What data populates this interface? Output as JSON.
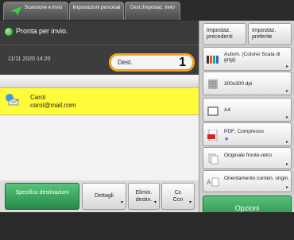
{
  "tabs": [
    {
      "label": "Scansione e invio"
    },
    {
      "label": "Impostazioni personali"
    },
    {
      "label": "Dest./Impostaz. invio"
    }
  ],
  "status": {
    "text": "Pronta per invio.",
    "datetime": "11/11 2020 14:20"
  },
  "destination": {
    "label": "Dest.",
    "count": "1"
  },
  "recipient": {
    "name": "Carol",
    "email": "carol@mail.com"
  },
  "bottom_buttons": {
    "specify": "Specifica destinazioni",
    "details": "Dettagli",
    "delete_line1": "Elimin.",
    "delete_line2": "destin.",
    "cc_line1": "Cc",
    "cc_line2": "Ccn"
  },
  "right_panel": {
    "previous": "Impostaz. precedenti",
    "preferred": "Impostaz. preferite",
    "color_mode": "Autom. (Colore/ Scala di grigi)",
    "resolution": "300x300 dpi",
    "paper": "A4",
    "file_format": "PDF; Compresso",
    "original_type": "Originale fronte-retro",
    "orientation": "Orientamento conten. origin.",
    "options": "Opzioni"
  },
  "colors": {
    "accent_green": "#26894a",
    "highlight": "#fffb3a",
    "dest_border": "#f3a322"
  }
}
